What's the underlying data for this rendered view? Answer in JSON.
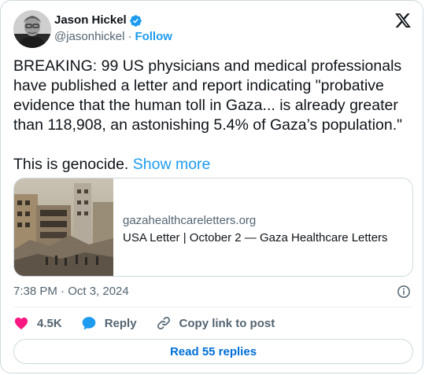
{
  "author": {
    "name": "Jason Hickel",
    "handle": "@jasonhickel",
    "separator": "·",
    "follow_label": "Follow"
  },
  "tweet": {
    "text": "BREAKING: 99 US physicians and medical professionals have published a letter and report indicating \"probative evidence that the human toll in Gaza... is already greater than 118,908, an astonishing 5.4% of Gaza’s population.\"",
    "text2": "This is genocide.",
    "show_more": "Show more"
  },
  "link_card": {
    "domain": "gazahealthcareletters.org",
    "title": "USA Letter | October 2 — Gaza Healthcare Letters"
  },
  "timestamp": "7:38 PM · Oct 3, 2024",
  "actions": {
    "likes": "4.5K",
    "reply": "Reply",
    "copy": "Copy link to post"
  },
  "read_replies": "Read 55 replies",
  "colors": {
    "accent": "#1d9bf0",
    "like": "#f91880",
    "text": "#0f1419",
    "muted": "#536471"
  },
  "icons": [
    "verified-badge-icon",
    "x-logo-icon",
    "info-icon",
    "heart-icon",
    "reply-bubble-icon",
    "link-icon"
  ]
}
